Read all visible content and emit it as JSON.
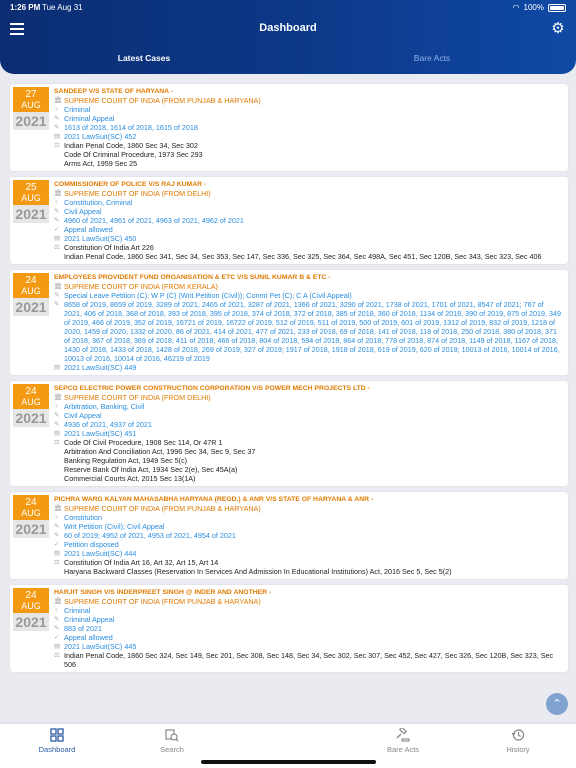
{
  "status": {
    "time": "1:26 PM",
    "date": "Tue Aug 31",
    "battery": "100%"
  },
  "header": {
    "title": "Dashboard"
  },
  "tabs": [
    {
      "label": "Latest Cases"
    },
    {
      "label": "Bare Acts"
    }
  ],
  "cases": [
    {
      "day": "27",
      "month": "AUG",
      "year": "2021",
      "title": "SANDEEP V/S STATE OF HARYANA -",
      "court": "SUPREME COURT OF INDIA (FROM PUNJAB & HARYANA)",
      "category": "Criminal",
      "case_type": "Criminal Appeal",
      "case_numbers": "1613 of 2018, 1614 of 2018, 1615 of 2018",
      "disposal": "",
      "citation": "2021 LawSuit(SC) 452",
      "acts": [
        "Indian Penal Code, 1860  Sec 34, Sec 302",
        "Code Of Criminal Procedure, 1973  Sec 293",
        "Arms Act, 1959  Sec 25"
      ]
    },
    {
      "day": "25",
      "month": "AUG",
      "year": "2021",
      "title": "COMMISSIONER OF POLICE V/S RAJ KUMAR -",
      "court": "SUPREME COURT OF INDIA (FROM DELHI)",
      "category": "Constitution, Criminal",
      "case_type": "Civil Appeal",
      "case_numbers": "4960 of 2021, 4961 of 2021, 4963 of 2021, 4962 of 2021",
      "disposal": "Appeal allowed",
      "citation": "2021 LawSuit(SC) 450",
      "acts": [
        "Constitution Of India  Art 226",
        "Indian Penal Code, 1860  Sec 341, Sec 34, Sec 353, Sec 147, Sec 336, Sec 325, Sec 364, Sec 498A, Sec 451, Sec 120B, Sec 343, Sec 323, Sec 406"
      ]
    },
    {
      "day": "24",
      "month": "AUG",
      "year": "2021",
      "title": "EMPLOYEES PROVIDENT FUND ORGANISATION & ETC V/S SUNIL KUMAR B & ETC -",
      "court": "SUPREME COURT OF INDIA (FROM KERALA)",
      "category": "",
      "case_type": "Special Leave Petition (C); W P (C) (Writ Petition (Civil)); Conmt Pet (C); C A (Civil Appeal)",
      "case_numbers": "8658 of 2019, 8659 of 2019, 3289 of 2021, 2465 of 2021, 3287 of 2021, 1366 of 2021, 3290 of 2021, 1738 of 2021, 1701 of 2021, 8547 of 2021; 767 of 2021, 406 of 2018, 368 of 2018, 393 of 2018, 395 of 2018, 374 of 2018, 372 of 2018, 385 of 2018, 360 of 2018, 1134 of 2018, 390 of 2019, 875 of 2019, 349 of 2019, 466 of 2019, 352 of 2019, 16721 of 2019, 16722 of 2019, 512 of 2019, 511 of 2019, 500 of 2019, 601 of 2019, 1312 of 2019, 832 of 2019, 1218 of 2020, 1459 of 2020, 1332 of 2020, 86 of 2021, 414 of 2021, 477 of 2021, 233 of 2018, 69 of 2018, 141 of 2018, 118 of 2018, 250 of 2018, 380 of 2018, 371 of 2018, 367 of 2018, 369 of 2018, 411 of 2018, 466 of 2018, 804 of 2018, 594 of 2018, 864 of 2018, 778 of 2018, 874 of 2018, 1149 of 2018, 1167 of 2018, 1430 of 2018, 1433 of 2018, 1428 of 2018, 269 of 2019, 327 of 2019; 1917 of 2018, 1918 of 2018, 619 of 2019, 620 of 2019; 10013 of 2016, 10014 of 2016, 10013 of 2016, 10014 of 2016, 46219 of 2019",
      "disposal": "",
      "citation": "2021 LawSuit(SC) 449",
      "acts": []
    },
    {
      "day": "24",
      "month": "AUG",
      "year": "2021",
      "title": "SEPCO ELECTRIC POWER CONSTRUCTION CORPORATION V/S POWER MECH PROJECTS LTD -",
      "court": "SUPREME COURT OF INDIA (FROM DELHI)",
      "category": "Arbitration, Banking, Civil",
      "case_type": "Civil Appeal",
      "case_numbers": "4936 of 2021, 4937 of 2021",
      "disposal": "",
      "citation": "2021 LawSuit(SC) 451",
      "acts": [
        "Code Of Civil Procedure, 1908  Sec 114, Or 47R 1",
        "Arbitration And Conciliation Act, 1996  Sec 34, Sec 9, Sec 37",
        "Banking Regulation Act, 1949  Sec 5(c)",
        "Reserve Bank Of India Act, 1934  Sec 2(e), Sec 45A(a)",
        "Commercial Courts Act, 2015  Sec 13(1A)"
      ]
    },
    {
      "day": "24",
      "month": "AUG",
      "year": "2021",
      "title": "PICHRA WARG KALYAN MAHASABHA HARYANA (REGD.) & ANR V/S STATE OF HARYANA & ANR -",
      "court": "SUPREME COURT OF INDIA (FROM PUNJAB & HARYANA)",
      "category": "Constitution",
      "case_type": "Writ Petition (Civil); Civil Appeal",
      "case_numbers": "60 of 2019; 4952 of 2021, 4953 of 2021, 4954 of 2021",
      "disposal": "Petition disposed",
      "citation": "2021 LawSuit(SC) 444",
      "acts": [
        "Constitution Of India  Art 16, Art 32, Art 15, Art 14",
        "Haryana Backward Classes (Reservation In Services And Admission In Educational Institutions) Act, 2016  Sec 5, Sec 5(2)"
      ]
    },
    {
      "day": "24",
      "month": "AUG",
      "year": "2021",
      "title": "HARJIT SINGH V/S INDERPREET SINGH @ INDER AND ANOTHER -",
      "court": "SUPREME COURT OF INDIA (FROM PUNJAB & HARYANA)",
      "category": "Criminal",
      "case_type": "Criminal Appeal",
      "case_numbers": "883 of 2021",
      "disposal": "Appeal allowed",
      "citation": "2021 LawSuit(SC) 445",
      "acts": [
        "Indian Penal Code, 1860  Sec 324, Sec 149, Sec 201, Sec 308, Sec 148, Sec 34, Sec 302, Sec 307, Sec 452, Sec 427, Sec 326, Sec 120B, Sec 323, Sec 506"
      ]
    }
  ],
  "bottom_nav": [
    {
      "label": "Dashboard",
      "icon": "dashboard-icon"
    },
    {
      "label": "Search",
      "icon": "search-icon"
    },
    {
      "label": "Bare Acts",
      "icon": "gavel-icon"
    },
    {
      "label": "History",
      "icon": "history-icon"
    }
  ]
}
